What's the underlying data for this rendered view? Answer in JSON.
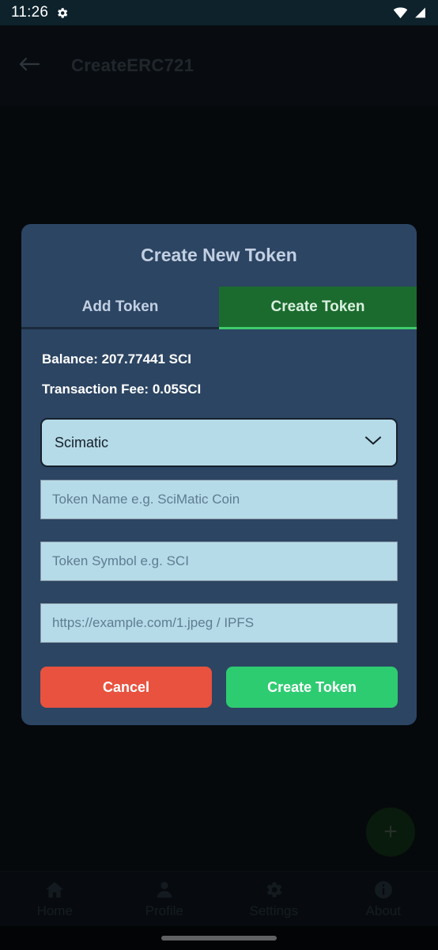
{
  "status_bar": {
    "time": "11:26",
    "icons": [
      "gear-icon",
      "wifi-icon",
      "cellular-signal-icon"
    ]
  },
  "app_bar": {
    "back_label": "back-arrow-icon",
    "title": "CreateERC721"
  },
  "fab": {
    "label": "+",
    "name": "add-fab"
  },
  "dialog": {
    "title": "Create New Token",
    "tabs": [
      {
        "label": "Add Token",
        "active": false
      },
      {
        "label": "Create Token",
        "active": true
      }
    ],
    "balance_line": "Balance: 207.77441 SCI",
    "fee_line": "Transaction Fee: 0.05SCI",
    "network_select": {
      "value": "Scimatic",
      "chevron": "chevron-down-icon"
    },
    "fields": [
      {
        "placeholder": "Token Name e.g. SciMatic Coin",
        "value": ""
      },
      {
        "placeholder": "Token Symbol e.g. SCI",
        "value": ""
      },
      {
        "placeholder": "https://example.com/1.jpeg / IPFS",
        "value": ""
      }
    ],
    "buttons": {
      "cancel": "Cancel",
      "create": "Create Token"
    }
  },
  "bottom_nav": [
    {
      "label": "Home",
      "icon": "home-icon"
    },
    {
      "label": "Profile",
      "icon": "person-icon"
    },
    {
      "label": "Settings",
      "icon": "gear-icon"
    },
    {
      "label": "About",
      "icon": "info-icon"
    }
  ],
  "colors": {
    "dialog_bg": "#2c4563",
    "tab_active_bg": "#1b6b2e",
    "tab_active_underline": "#3fcc6b",
    "field_bg": "#b6dbe8",
    "cancel_btn": "#e8523f",
    "create_btn": "#2ecc71",
    "page_bg": "#0a0e13",
    "status_bar_bg": "#0d222b"
  }
}
